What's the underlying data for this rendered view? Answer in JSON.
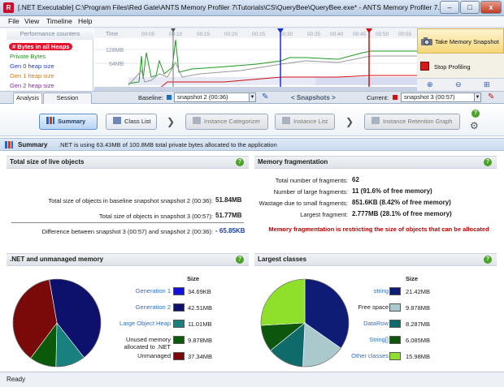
{
  "window": {
    "title": "[.NET Executable] C:\\Program Files\\Red Gate\\ANTS Memory Profiler 7\\Tutorials\\CS\\QueryBee\\QueryBee.exe* - ANTS Memory Profiler 7.0",
    "minimize": "–",
    "maximize": "□",
    "close": "x"
  },
  "menu": [
    "File",
    "View",
    "Timeline",
    "Help"
  ],
  "counters": {
    "header": "Performance counters",
    "items": [
      {
        "label": "# Bytes in all Heaps",
        "color": "#ffffff"
      },
      {
        "label": "Private Bytes",
        "color": "#1e9a1e"
      },
      {
        "label": "Gen 0 heap size",
        "color": "#1f3fd0"
      },
      {
        "label": "Gen 1 heap size",
        "color": "#d07a10"
      },
      {
        "label": "Gen 2 heap size",
        "color": "#8a2aa0"
      }
    ]
  },
  "graph": {
    "axis_time": "Time",
    "tick_128": "128MB",
    "tick_64": "64MB",
    "time_ticks": [
      "00:05",
      "00:10",
      "00:15",
      "00:20",
      "00:25",
      "00:30",
      "00:35",
      "00:40",
      "00:45",
      "00:50",
      "00:55"
    ]
  },
  "side": {
    "take_snapshot": "Take Memory Snapshot",
    "stop_profiling": "Stop Profiling"
  },
  "tabs": {
    "analysis": "Analysis",
    "session_overview": "Session Overview",
    "baseline_label": "Baseline:",
    "baseline_value": "snapshot 2 (00:36)",
    "snapshots_label": "< Snapshots >",
    "current_label": "Current:",
    "current_value": "snapshot 3 (00:57)"
  },
  "crumbs": {
    "summary": "Summary",
    "class_list": "Class List",
    "instance_categorizer": "Instance Categorizer",
    "instance_list": "Instance List",
    "instance_retention_graph": "Instance Retention Graph"
  },
  "summary": {
    "title": "Summary",
    "text": ".NET is using 63.43MB of 100.8MB total private bytes allocated to the application"
  },
  "live_objects": {
    "title": "Total size of live objects",
    "baseline_label": "Total size of objects in baseline snapshot snapshot 2 (00:36):",
    "baseline_value": "51.84MB",
    "current_label": "Total size of objects in snapshot 3 (00:57):",
    "current_value": "51.77MB",
    "diff_label": "Difference between snapshot 3 (00:57) and snapshot 2 (00:36):",
    "diff_value": "- 65.85KB"
  },
  "fragmentation": {
    "title": "Memory fragmentation",
    "rows": [
      {
        "label": "Total number of fragments:",
        "value": "62"
      },
      {
        "label": "Number of large fragments:",
        "value": "11 (91.6% of free memory)"
      },
      {
        "label": "Wastage due to small fragments:",
        "value": "851.6KB (8.42% of free memory)"
      },
      {
        "label": "Largest fragment:",
        "value": "2.777MB (28.1% of free memory)"
      }
    ],
    "warning": "Memory fragmentation is restricting the size of objects that can be allocated"
  },
  "net_unmanaged": {
    "title": ".NET and unmanaged memory",
    "size_header": "Size",
    "items": [
      {
        "name": "Generation 1",
        "size": "34.69KB",
        "color": "#1010d8",
        "link": true
      },
      {
        "name": "Generation 2",
        "size": "42.51MB",
        "color": "#0e116c",
        "link": true
      },
      {
        "name": "Large Object Heap",
        "size": "11.01MB",
        "color": "#1a7f7f",
        "link": true
      },
      {
        "name": "Unused memory allocated to .NET",
        "size": "9.878MB",
        "color": "#0b5a0b",
        "link": false
      },
      {
        "name": "Unmanaged",
        "size": "37.34MB",
        "color": "#7a0a0a",
        "link": false
      }
    ]
  },
  "largest_classes": {
    "title": "Largest classes",
    "size_header": "Size",
    "items": [
      {
        "name": "string",
        "size": "21.42MB",
        "color": "#0f1c76",
        "link": true
      },
      {
        "name": "Free space",
        "size": "9.878MB",
        "color": "#a9c9cc",
        "link": false
      },
      {
        "name": "DataRow",
        "size": "8.287MB",
        "color": "#0f6a6a",
        "link": true
      },
      {
        "name": "String[]",
        "size": "6.085MB",
        "color": "#0d560d",
        "link": true
      },
      {
        "name": "Other classes",
        "size": "15.98MB",
        "color": "#8fe02b",
        "link": true
      }
    ]
  },
  "status": "Ready"
}
